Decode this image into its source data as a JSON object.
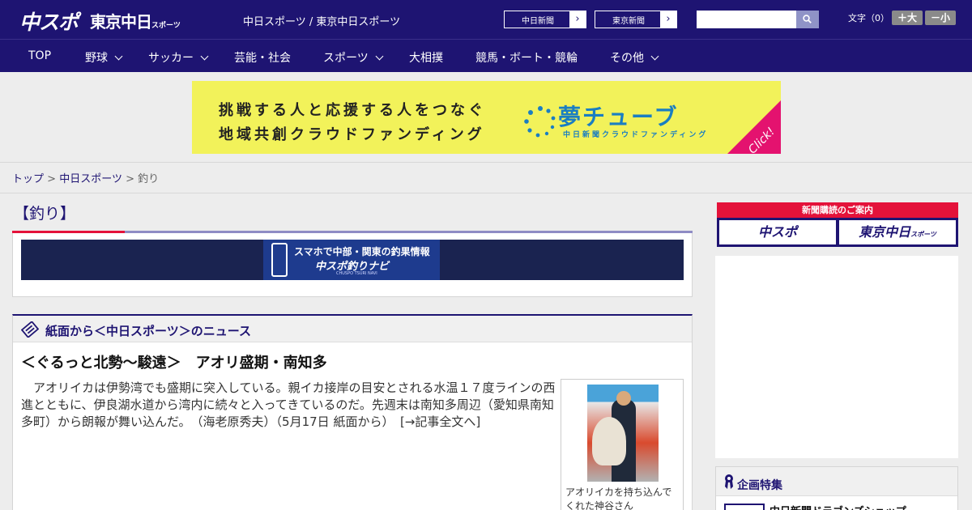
{
  "header": {
    "logo_chuspo": "中スポ",
    "logo_tokyo": "東京中日",
    "logo_tokyo_small": "スポーツ",
    "site_links": "中日スポーツ / 東京中日スポーツ",
    "newspaper_links": [
      {
        "label": "中日新聞",
        "arrow": "›"
      },
      {
        "label": "東京新聞",
        "arrow": "›"
      }
    ],
    "search": {
      "placeholder": "",
      "value": ""
    },
    "font_label": "文字（0）",
    "font_bigger": "＋大",
    "font_smaller": "－小"
  },
  "nav": {
    "items": [
      {
        "label": "TOP",
        "dropdown": false
      },
      {
        "label": "野球",
        "dropdown": true
      },
      {
        "label": "サッカー",
        "dropdown": true
      },
      {
        "label": "芸能・社会",
        "dropdown": false
      },
      {
        "label": "スポーツ",
        "dropdown": true
      },
      {
        "label": "大相撲",
        "dropdown": false
      },
      {
        "label": "競馬・ボート・競輪",
        "dropdown": false
      },
      {
        "label": "その他",
        "dropdown": true
      }
    ]
  },
  "banner": {
    "line1": "挑戦する人と応援する人をつなぐ",
    "line2": "地域共創クラウドファンディング",
    "brand": "夢チューブ",
    "brand_sub": "中日新聞クラウドファンディング",
    "click": "Click!"
  },
  "breadcrumb": {
    "home": "トップ",
    "sep": ">",
    "section": "中日スポーツ",
    "current": "釣り"
  },
  "page": {
    "title": "【釣り】"
  },
  "navi_banner": {
    "line1": "スマホで中部・関東の釣果情報",
    "line2": "中スポ釣りナビ",
    "line3": "CHUSPO TSURI NAVI"
  },
  "news": {
    "section_title": "紙面から＜中日スポーツ＞のニュース",
    "article_title": "＜ぐるっと北勢～駿遠＞　アオリ盛期・南知多",
    "article_text": "　アオリイカは伊勢湾でも盛期に突入している。親イカ接岸の目安とされる水温１７度ラインの西進とともに、伊良湖水道から湾内に続々と入ってきているのだ。先週末は南知多周辺（愛知県南知多町）から朗報が舞い込んだ。　（海老原秀夫）（5月17日 紙面から）　",
    "more_link": "[→記事全文へ]",
    "photo_caption": "アオリイカを持ち込んでくれた神谷さん"
  },
  "sidebar": {
    "subscription_title": "新聞購読のご案内",
    "sub_buttons": [
      "中スポ",
      "東京中日"
    ],
    "sub_button_small": "スポーツ",
    "feature_title": "企画特集",
    "feature_item": "中日新聞ドラゴンズショップ"
  },
  "colors": {
    "brand_navy": "#1e1472",
    "accent_red": "#e4123a",
    "banner_yellow": "#f2f25a",
    "yume_blue": "#1a7ec2"
  }
}
